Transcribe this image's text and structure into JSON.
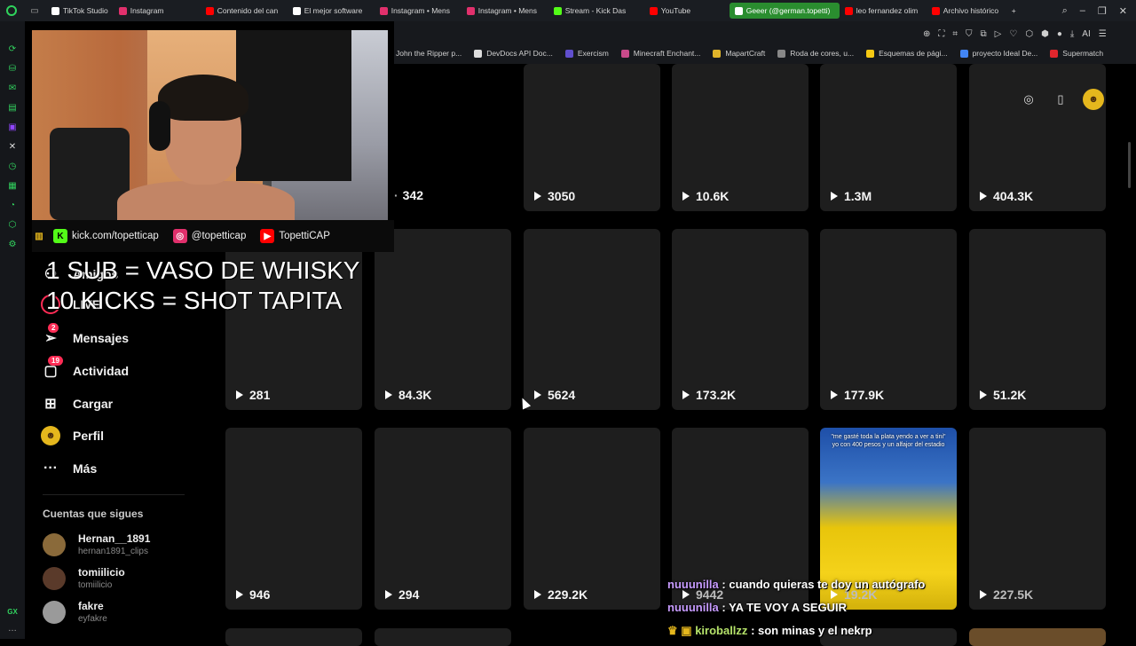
{
  "browser": {
    "tabs": [
      {
        "label": "TikTok Studio",
        "color": "#ffffff"
      },
      {
        "label": "Instagram",
        "color": "#e1306c"
      },
      {
        "label": "Contenido del can",
        "color": "#ff0000"
      },
      {
        "label": "El mejor software",
        "color": "#ffffff"
      },
      {
        "label": "Instagram • Mens",
        "color": "#e1306c"
      },
      {
        "label": "Instagram • Mens",
        "color": "#e1306c"
      },
      {
        "label": "Stream - Kick Das",
        "color": "#53fc18"
      },
      {
        "label": "YouTube",
        "color": "#ff0000"
      },
      {
        "label": "Geeer (@german.topetti)",
        "color": "#ffffff",
        "active": true
      },
      {
        "label": "leo fernandez olim",
        "color": "#ff0000"
      },
      {
        "label": "Archivo histórico",
        "color": "#ff0000"
      }
    ],
    "new_tab": "+",
    "bookmarks": [
      {
        "label": "John the Ripper p...",
        "color": "#555555"
      },
      {
        "label": "DevDocs API Doc...",
        "color": "#dddddd"
      },
      {
        "label": "Exercism",
        "color": "#604fcd"
      },
      {
        "label": "Minecraft Enchant...",
        "color": "#c94a8a"
      },
      {
        "label": "MapartCraft",
        "color": "#e0b42a"
      },
      {
        "label": "Roda de cores, u...",
        "color": "#888888"
      },
      {
        "label": "Esquemas de pági...",
        "color": "#f6c913"
      },
      {
        "label": "proyecto Ideal De...",
        "color": "#4285f4"
      },
      {
        "label": "Supermatch",
        "color": "#e0262d"
      }
    ],
    "toolbar_ai": "AI"
  },
  "stream_overlay": {
    "social": [
      {
        "label": "kick.com/topetticap",
        "icon": "kick-icon",
        "color": "#53fc18"
      },
      {
        "label": "@topetticap",
        "icon": "instagram-icon",
        "color": "#e1306c"
      },
      {
        "label": "TopettiCAP",
        "icon": "youtube-icon",
        "color": "#ff0000"
      }
    ],
    "line1": "1 SUB = VASO DE WHISKY",
    "line2": "10 KICKS = SHOT TAPITA"
  },
  "nav": {
    "items": [
      {
        "label": "Amigos",
        "icon": "friends-icon"
      },
      {
        "label": "LIVE",
        "icon": "live-icon"
      },
      {
        "label": "Mensajes",
        "icon": "messages-icon",
        "badge": "2"
      },
      {
        "label": "Actividad",
        "icon": "activity-icon",
        "badge": "19"
      },
      {
        "label": "Cargar",
        "icon": "upload-icon"
      },
      {
        "label": "Perfil",
        "icon": "profile-icon"
      },
      {
        "label": "Más",
        "icon": "more-icon"
      }
    ],
    "following_title": "Cuentas que sigues",
    "following": [
      {
        "name": "Hernan__1891",
        "handle": "hernan1891_clips",
        "color": "#8a6a3a"
      },
      {
        "name": "tomiilicio",
        "handle": "tomiilicio",
        "color": "#5a3a2a"
      },
      {
        "name": "fakre",
        "handle": "eyfakre",
        "color": "#9a9a9a"
      }
    ]
  },
  "grid": {
    "row1": [
      "342",
      "3050",
      "10.6K",
      "1.3M",
      "404.3K"
    ],
    "row2": [
      "281",
      "84.3K",
      "5624",
      "173.2K",
      "177.9K",
      "51.2K"
    ],
    "row3": [
      "946",
      "294",
      "229.2K",
      "9442",
      "19.2K",
      "227.5K"
    ],
    "featured_caption": "\"me gasté toda la plata yendo a ver a tini\" yo con 400 pesos y un alfajor del estadio"
  },
  "chat": [
    {
      "user": "nuuunilla",
      "message": ": cuando quieras te doy un autógrafo"
    },
    {
      "user": "nuuunilla",
      "message": ": YA TE VOY A SEGUIR"
    },
    {
      "user": "kiroballzz",
      "message": ": son minas y el nekrp"
    }
  ]
}
